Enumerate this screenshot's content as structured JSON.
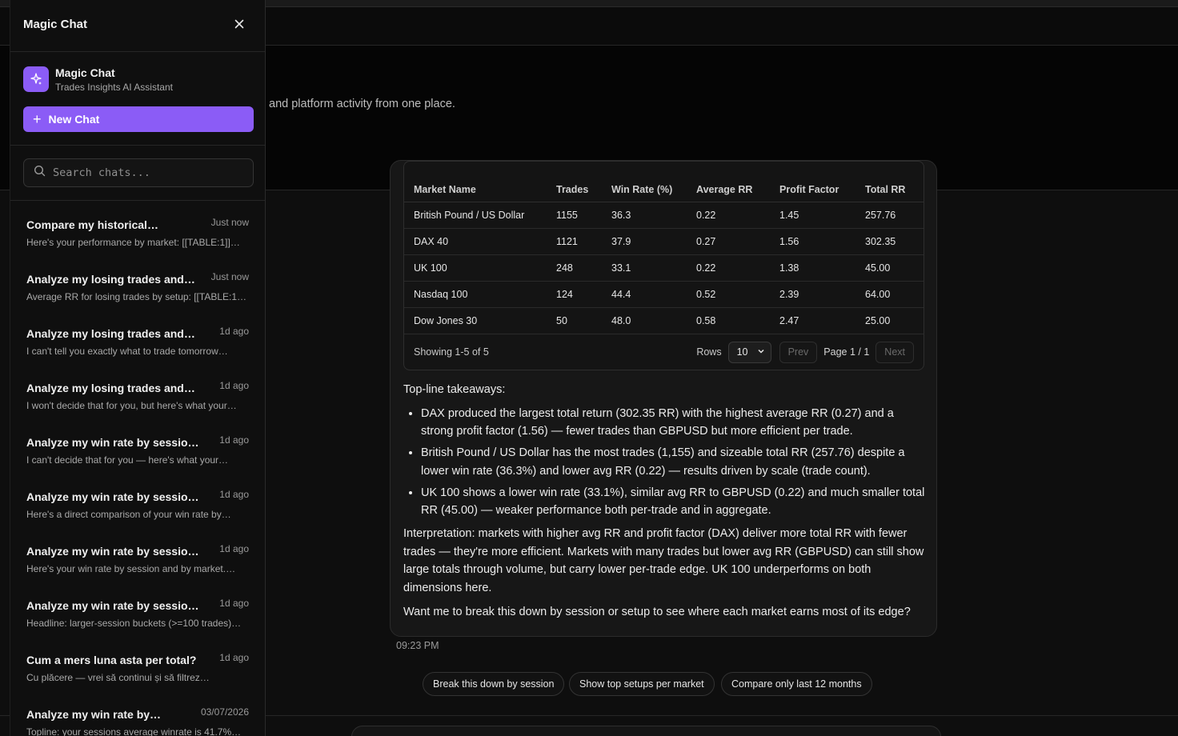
{
  "hero": {
    "subtitle": "and platform activity from one place."
  },
  "sidebar": {
    "title": "Magic Chat",
    "brand_name": "Magic Chat",
    "brand_subtitle": "Trades Insights AI Assistant",
    "new_chat_label": "New Chat",
    "search_placeholder": "Search chats...",
    "chats": [
      {
        "title": "Compare my historical…",
        "time": "Just now",
        "preview": "Here's your performance by market: [[TABLE:1]]…"
      },
      {
        "title": "Analyze my losing trades and…",
        "time": "Just now",
        "preview": "Average RR for losing trades by setup: [[TABLE:1]]…"
      },
      {
        "title": "Analyze my losing trades and…",
        "time": "1d ago",
        "preview": "I can't tell you exactly what to trade tomorrow…"
      },
      {
        "title": "Analyze my losing trades and…",
        "time": "1d ago",
        "preview": "I won't decide that for you, but here's what your…"
      },
      {
        "title": "Analyze my win rate by sessions…",
        "time": "1d ago",
        "preview": "I can't decide that for you — here's what your…"
      },
      {
        "title": "Analyze my win rate by sessions…",
        "time": "1d ago",
        "preview": "Here's a direct comparison of your win rate by…"
      },
      {
        "title": "Analyze my win rate by sessions…",
        "time": "1d ago",
        "preview": "Here's your win rate by session and by market.…"
      },
      {
        "title": "Analyze my win rate by sessions…",
        "time": "1d ago",
        "preview": "Headline: larger-session buckets (>=100 trades)…"
      },
      {
        "title": "Cum a mers luna asta per total?",
        "time": "1d ago",
        "preview": "Cu plăcere — vrei să continui și să filtrez…"
      },
      {
        "title": "Analyze my win rate by…",
        "time": "03/07/2026",
        "preview": "Topline: your sessions average winrate is 41.7%…"
      }
    ]
  },
  "table": {
    "headers": [
      "Market Name",
      "Trades",
      "Win Rate (%)",
      "Average RR",
      "Profit Factor",
      "Total RR"
    ],
    "rows": [
      [
        "British Pound / US Dollar",
        "1155",
        "36.3",
        "0.22",
        "1.45",
        "257.76"
      ],
      [
        "DAX 40",
        "1121",
        "37.9",
        "0.27",
        "1.56",
        "302.35"
      ],
      [
        "UK 100",
        "248",
        "33.1",
        "0.22",
        "1.38",
        "45.00"
      ],
      [
        "Nasdaq 100",
        "124",
        "44.4",
        "0.52",
        "2.39",
        "64.00"
      ],
      [
        "Dow Jones 30",
        "50",
        "48.0",
        "0.58",
        "2.47",
        "25.00"
      ]
    ],
    "showing": "Showing 1-5 of 5",
    "rows_label": "Rows",
    "rows_value": "10",
    "prev_label": "Prev",
    "page_label": "Page 1 / 1",
    "next_label": "Next"
  },
  "message": {
    "takeaways_heading": "Top-line takeaways:",
    "bullets": [
      "DAX produced the largest total return (302.35 RR) with the highest average RR (0.27) and a strong profit factor (1.56) — fewer trades than GBPUSD but more efficient per trade.",
      "British Pound / US Dollar has the most trades (1,155) and sizeable total RR (257.76) despite a lower win rate (36.3%) and lower avg RR (0.22) — results driven by scale (trade count).",
      "UK 100 shows a lower win rate (33.1%), similar avg RR to GBPUSD (0.22) and much smaller total RR (45.00) — weaker performance both per-trade and in aggregate."
    ],
    "interpretation": "Interpretation: markets with higher avg RR and profit factor (DAX) deliver more total RR with fewer trades — they're more efficient. Markets with many trades but lower avg RR (GBPUSD) can still show large totals through volume, but carry lower per-trade edge. UK 100 underperforms on both dimensions here.",
    "question": "Want me to break this down by session or setup to see where each market earns most of its edge?",
    "time": "09:23 PM"
  },
  "suggestions": [
    "Break this down by session",
    "Show top setups per market",
    "Compare only last 12 months"
  ],
  "colors": {
    "accent": "#8b5cf6",
    "background": "#0a0a0a",
    "panel": "#0f0f0f"
  },
  "icons": {
    "close": "close-icon",
    "brand": "sparkles-icon",
    "new_chat": "plus-icon",
    "search": "search-icon",
    "rows_select": "chevron-down-icon"
  }
}
